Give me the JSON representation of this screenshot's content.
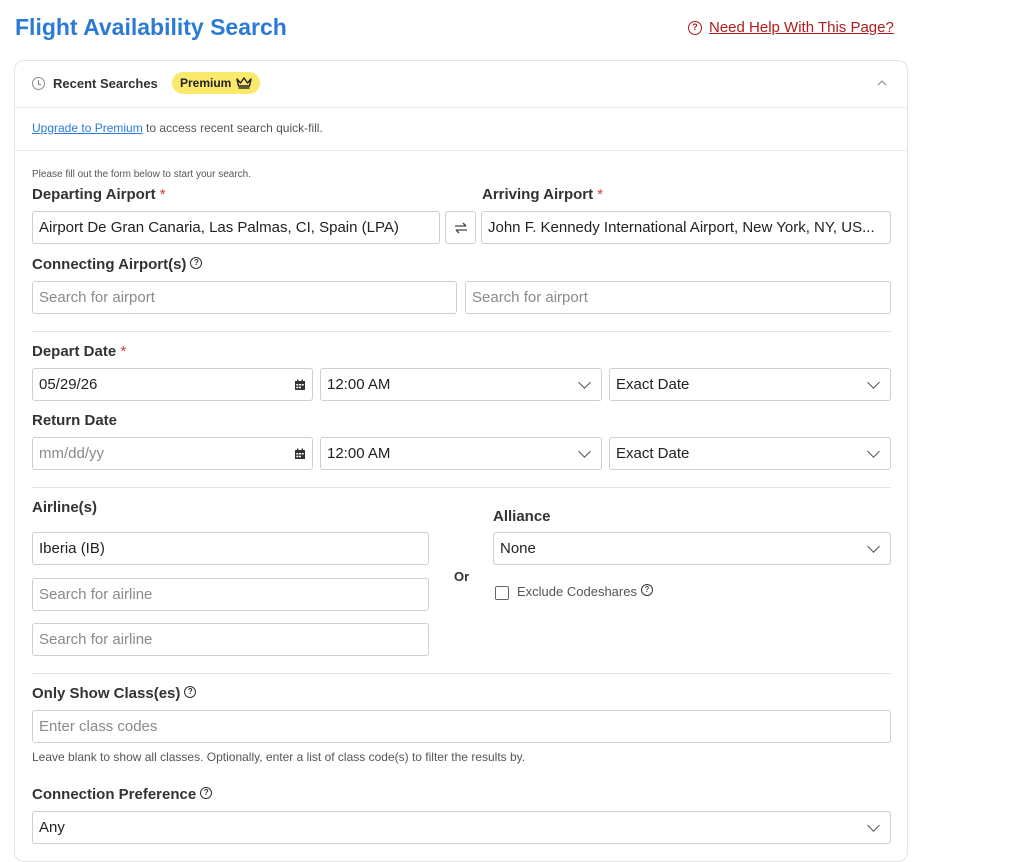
{
  "page": {
    "title": "Flight Availability Search",
    "help_link": "Need Help With This Page?"
  },
  "recent": {
    "label": "Recent Searches",
    "badge": "Premium",
    "upgrade_link": "Upgrade to Premium",
    "upgrade_text": " to access recent search quick-fill."
  },
  "form": {
    "note": "Please fill out the form below to start your search.",
    "departing": {
      "label": "Departing Airport",
      "value": "Airport De Gran Canaria, Las Palmas, CI, Spain (LPA)"
    },
    "arriving": {
      "label": "Arriving Airport",
      "value": "John F. Kennedy International Airport, New York, NY, US..."
    },
    "required_mark": "*",
    "connecting": {
      "label": "Connecting Airport(s)",
      "placeholder1": "Search for airport",
      "placeholder2": "Search for airport"
    },
    "depart": {
      "label": "Depart Date",
      "date": "05/29/26",
      "time": "12:00 AM",
      "flex": "Exact Date"
    },
    "return": {
      "label": "Return Date",
      "date_placeholder": "mm/dd/yy",
      "time": "12:00 AM",
      "flex": "Exact Date"
    },
    "airlines": {
      "label": "Airline(s)",
      "value1": "Iberia (IB)",
      "placeholder2": "Search for airline",
      "placeholder3": "Search for airline",
      "or": "Or"
    },
    "alliance": {
      "label": "Alliance",
      "value": "None",
      "exclude_label": "Exclude Codeshares"
    },
    "classes": {
      "label": "Only Show Class(es)",
      "placeholder": "Enter class codes",
      "hint": "Leave blank to show all classes. Optionally, enter a list of class code(s) to filter the results by."
    },
    "connection": {
      "label": "Connection Preference",
      "value": "Any"
    }
  },
  "colors": {
    "title": "#2b7bd6",
    "help": "#b01a1a",
    "badge": "#fbe96b",
    "required": "#d23a3a"
  }
}
